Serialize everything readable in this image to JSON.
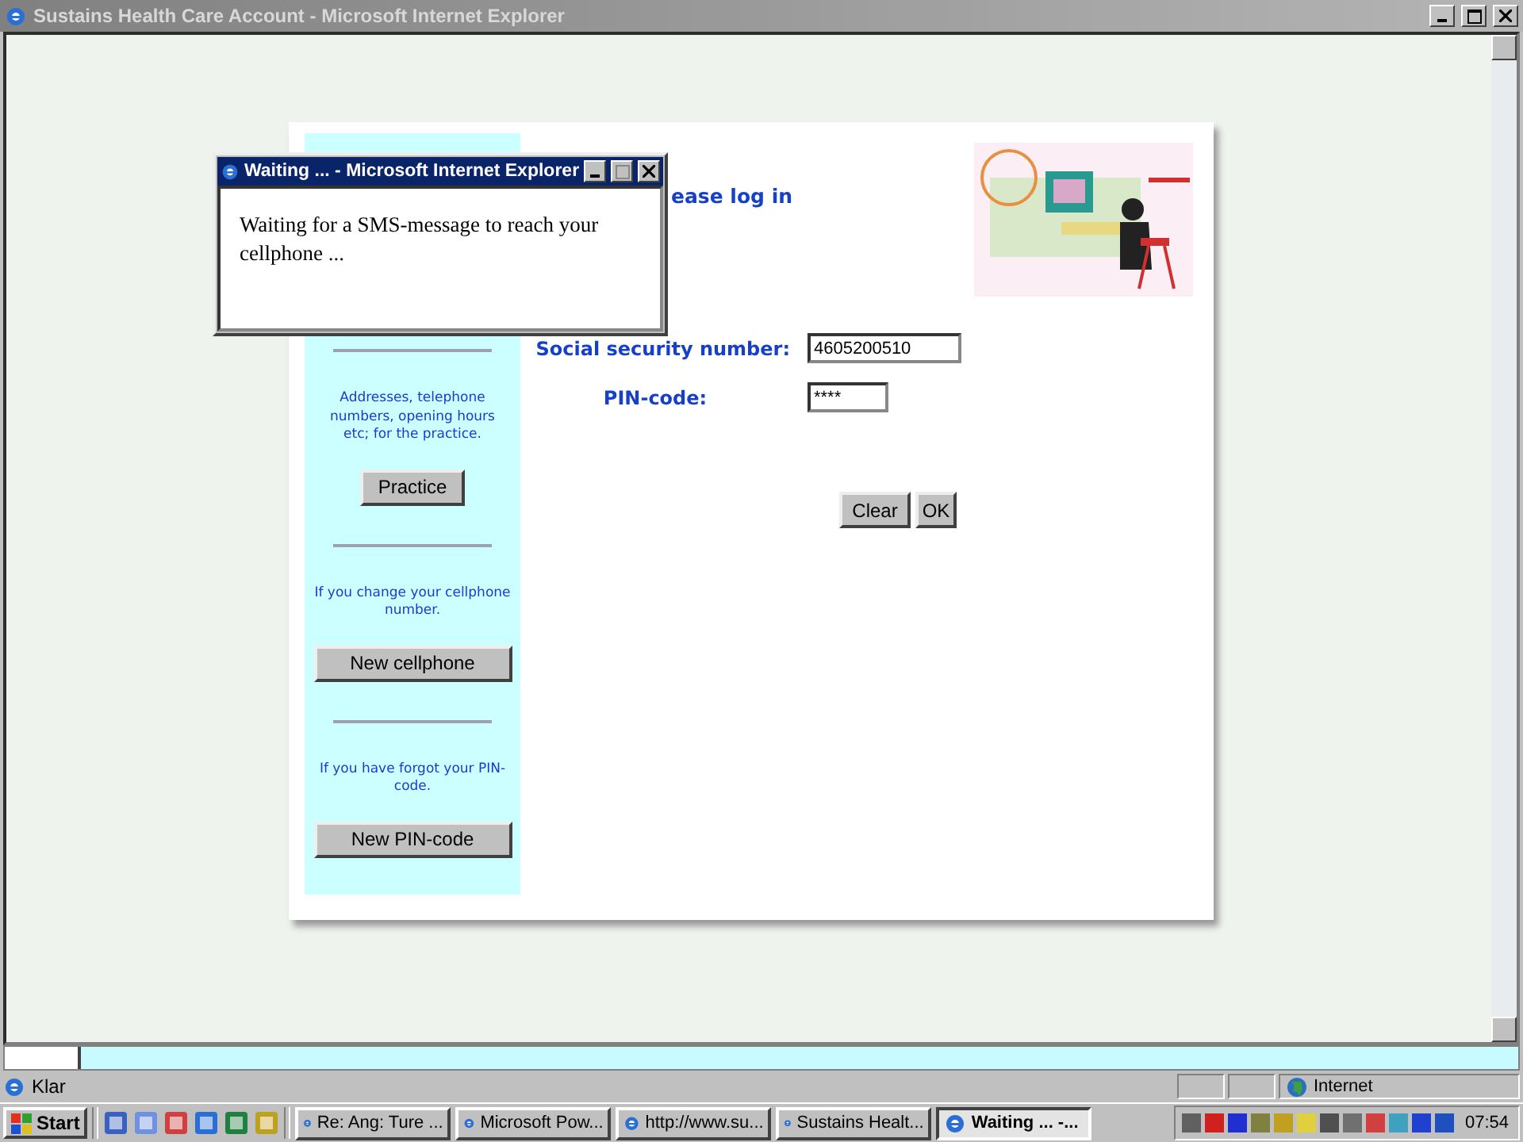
{
  "window": {
    "title": "Sustains Health Care Account - Microsoft Internet Explorer"
  },
  "sidebar": {
    "sections": [
      {
        "text": "Addresses, telephone numbers, opening hours etc; for the practice.",
        "button": "Practice",
        "wide": false
      },
      {
        "text": "If you change your cellphone number.",
        "button": "New cellphone",
        "wide": true
      },
      {
        "text": "If you have forgot your PIN-code.",
        "button": "New PIN-code",
        "wide": true
      }
    ]
  },
  "login": {
    "heading": "ease log in",
    "fields": [
      {
        "label": "Social security number:",
        "value": "4605200510",
        "kind": "text"
      },
      {
        "label": "PIN-code:",
        "value": "****",
        "kind": "password"
      }
    ],
    "buttons": [
      "Clear",
      "OK"
    ],
    "illustration": {
      "kind": "picture"
    }
  },
  "dialog": {
    "title": "Waiting ... - Microsoft Internet Explorer",
    "message": "Waiting for a SMS-message to reach your cellphone ..."
  },
  "status_bar": {
    "text": "Klar",
    "zone": "Internet"
  },
  "taskbar": {
    "start": "Start",
    "tasks": [
      {
        "label": "Re: Ang: Ture ...",
        "selected": false
      },
      {
        "label": "Microsoft Pow...",
        "selected": false
      },
      {
        "label": "http://www.su...",
        "selected": false
      },
      {
        "label": "Sustains Healt...",
        "selected": false
      },
      {
        "label": "Waiting ... -...",
        "selected": true
      }
    ],
    "clock": "07:54"
  }
}
